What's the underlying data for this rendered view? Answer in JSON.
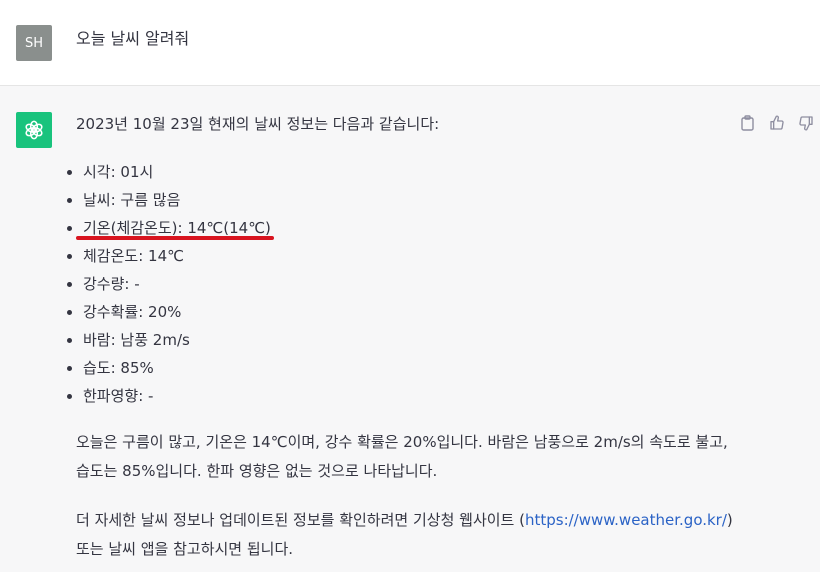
{
  "user": {
    "avatar_initials": "SH",
    "message": "오늘 날씨 알려줘"
  },
  "assistant": {
    "intro": "2023년 10월 23일 현재의 날씨 정보는 다음과 같습니다:",
    "bullets": [
      "시각: 01시",
      "날씨: 구름 많음",
      "기온(체감온도): 14℃(14℃)",
      "체감온도: 14℃",
      "강수량: -",
      "강수확률: 20%",
      "바람: 남풍 2m/s",
      "습도: 85%",
      "한파영향: -"
    ],
    "paragraph1": "오늘은 구름이 많고, 기온은 14℃이며, 강수 확률은 20%입니다. 바람은 남풍으로 2m/s의 속도로 불고, 습도는 85%입니다. 한파 영향은 없는 것으로 나타납니다.",
    "paragraph2_before": "더 자세한 날씨 정보나 업데이트된 정보를 확인하려면 기상청 웹사이트 (",
    "paragraph2_link": "https://www.weather.go.kr/",
    "paragraph2_after": ") 또는 날씨 앱을 참고하시면 됩니다."
  },
  "icons": {
    "copy": "clipboard-icon",
    "thumbs_up": "thumbs-up-icon",
    "thumbs_down": "thumbs-down-icon",
    "bot_logo": "openai-logo-icon"
  },
  "colors": {
    "bot_avatar": "#19c37d",
    "user_avatar": "#8a8f8d",
    "annotation_underline": "#d8141f",
    "link": "#2b63c6"
  }
}
